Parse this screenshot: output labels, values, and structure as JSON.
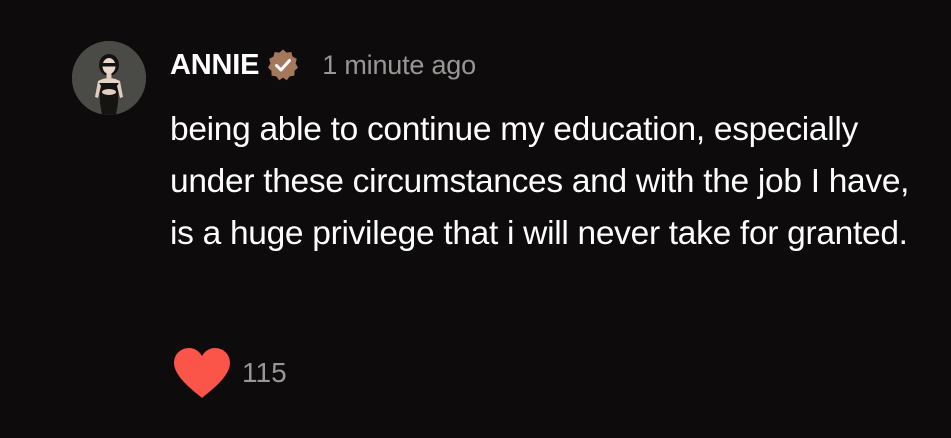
{
  "comment": {
    "username": "ANNIE",
    "verified_badge_icon": "verified-check-badge-icon",
    "timestamp": "1 minute ago",
    "body": "being able to continue my education, especially under these circumstances and with the job I have, is a huge privilege that i will never take for granted.",
    "like_icon": "heart-icon",
    "like_count": "115"
  },
  "colors": {
    "background": "#0d0b0b",
    "text": "#ffffff",
    "muted_text": "#9a9696",
    "badge": "#a5785c",
    "heart": "#fb5448"
  }
}
